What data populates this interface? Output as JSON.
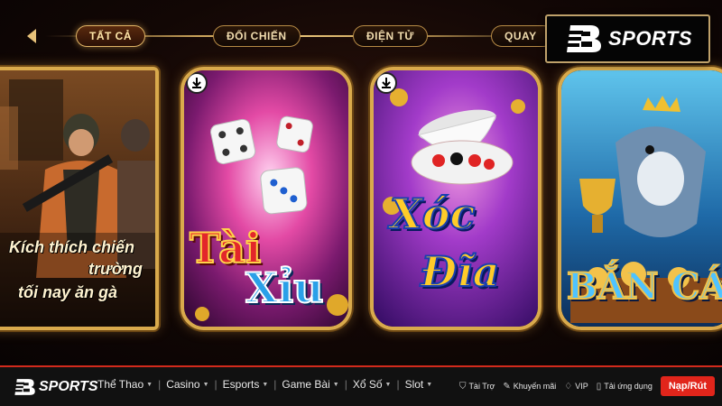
{
  "tabs": [
    {
      "label": "TẤT CẢ",
      "active": true
    },
    {
      "label": "ĐỐI CHIẾN",
      "active": false
    },
    {
      "label": "ĐIỆN TỬ",
      "active": false
    },
    {
      "label": "QUAY",
      "active": false
    }
  ],
  "brand": {
    "name": "SPORTS"
  },
  "cards": [
    {
      "id": "pubg",
      "lines": [
        "Kích thích chiến",
        "trường",
        "tối nay ăn gà"
      ]
    },
    {
      "id": "tai-xiu",
      "title_top": "Tài",
      "title_bottom": "Xỉu"
    },
    {
      "id": "xoc-dia",
      "title_top": "Xóc",
      "title_bottom": "Đĩa"
    },
    {
      "id": "ban-ca",
      "title": "BẮN CÁ"
    }
  ],
  "bottom_nav": {
    "logo": "SPORTS",
    "menu": [
      {
        "label": "Thể Thao"
      },
      {
        "label": "Casino"
      },
      {
        "label": "Esports"
      },
      {
        "label": "Game Bài"
      },
      {
        "label": "Xổ Số"
      },
      {
        "label": "Slot"
      }
    ],
    "links": [
      {
        "label": "Tài Trợ",
        "icon": "shield-icon"
      },
      {
        "label": "Khuyến mãi",
        "icon": "tag-icon"
      },
      {
        "label": "VIP",
        "icon": "diamond-icon"
      },
      {
        "label": "Tải ứng dụng",
        "icon": "phone-icon"
      }
    ],
    "deposit_label": "Nạp/Rút"
  },
  "colors": {
    "accent_gold": "#d9aa4c",
    "nav_red": "#e1251b"
  }
}
